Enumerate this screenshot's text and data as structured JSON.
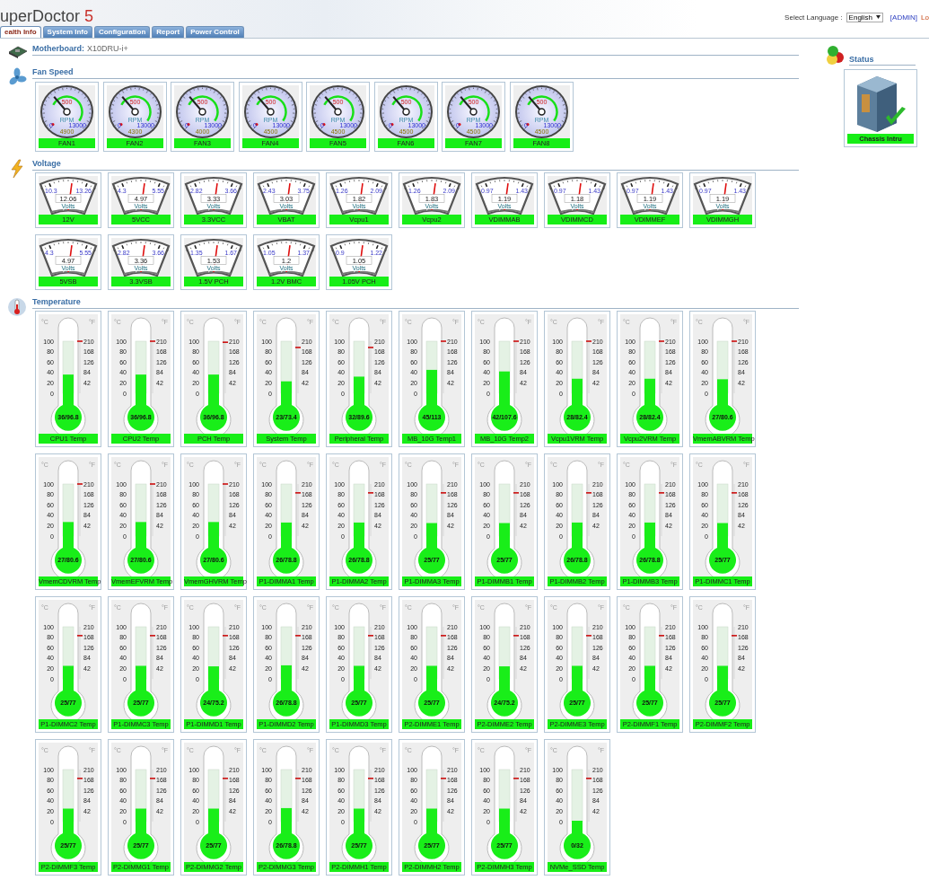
{
  "header": {
    "logo": {
      "name": "uperDoctor",
      "version": "5"
    },
    "tabs": [
      {
        "label": "ealth Info",
        "selected": true
      },
      {
        "label": "System Info",
        "selected": false
      },
      {
        "label": "Configuration",
        "selected": false
      },
      {
        "label": "Report",
        "selected": false
      },
      {
        "label": "Power Control",
        "selected": false
      }
    ],
    "language": {
      "label": "Select Language :",
      "value": "English"
    },
    "user": "[ADMIN]",
    "logout": "Lo"
  },
  "motherboard": {
    "label": "Motherboard:",
    "value": "X10DRU-i+"
  },
  "sections": [
    {
      "kind": "fan",
      "title": "Fan Speed",
      "gauges": [
        {
          "name": "FAN1",
          "limit": "500",
          "unit": "RPM",
          "min": "0",
          "max": "13000",
          "reading": "4900"
        },
        {
          "name": "FAN2",
          "limit": "500",
          "unit": "RPM",
          "min": "0",
          "max": "13000",
          "reading": "4300"
        },
        {
          "name": "FAN3",
          "limit": "500",
          "unit": "RPM",
          "min": "0",
          "max": "13000",
          "reading": "4000"
        },
        {
          "name": "FAN4",
          "limit": "500",
          "unit": "RPM",
          "min": "0",
          "max": "13000",
          "reading": "4500"
        },
        {
          "name": "FAN5",
          "limit": "500",
          "unit": "RPM",
          "min": "0",
          "max": "13000",
          "reading": "4500"
        },
        {
          "name": "FAN6",
          "limit": "500",
          "unit": "RPM",
          "min": "0",
          "max": "13000",
          "reading": "4500"
        },
        {
          "name": "FAN7",
          "limit": "500",
          "unit": "RPM",
          "min": "0",
          "max": "13000",
          "reading": "4500"
        },
        {
          "name": "FAN8",
          "limit": "500",
          "unit": "RPM",
          "min": "0",
          "max": "13000",
          "reading": "4500"
        }
      ]
    },
    {
      "kind": "voltage",
      "title": "Voltage",
      "gauges": [
        {
          "name": "12V",
          "min": "10.3",
          "max": "13.26",
          "reading": "12.06",
          "unit": "Volts"
        },
        {
          "name": "5VCC",
          "min": "4.3",
          "max": "5.55",
          "reading": "4.97",
          "unit": "Volts"
        },
        {
          "name": "3.3VCC",
          "min": "2.82",
          "max": "3.66",
          "reading": "3.33",
          "unit": "Volts"
        },
        {
          "name": "VBAT",
          "min": "2.43",
          "max": "3.75",
          "reading": "3.03",
          "unit": "Volts"
        },
        {
          "name": "Vcpu1",
          "min": "1.26",
          "max": "2.09",
          "reading": "1.82",
          "unit": "Volts"
        },
        {
          "name": "Vcpu2",
          "min": "1.26",
          "max": "2.09",
          "reading": "1.83",
          "unit": "Volts"
        },
        {
          "name": "VDIMMAB",
          "min": "0.97",
          "max": "1.43",
          "reading": "1.19",
          "unit": "Volts"
        },
        {
          "name": "VDIMMCD",
          "min": "0.97",
          "max": "1.43",
          "reading": "1.18",
          "unit": "Volts"
        },
        {
          "name": "VDIMMEF",
          "min": "0.97",
          "max": "1.43",
          "reading": "1.19",
          "unit": "Volts"
        },
        {
          "name": "VDIMMGH",
          "min": "0.97",
          "max": "1.43",
          "reading": "1.19",
          "unit": "Volts"
        },
        {
          "name": "5VSB",
          "min": "4.3",
          "max": "5.55",
          "reading": "4.97",
          "unit": "Volts"
        },
        {
          "name": "3.3VSB",
          "min": "2.82",
          "max": "3.66",
          "reading": "3.36",
          "unit": "Volts"
        },
        {
          "name": "1.5V PCH",
          "min": "1.35",
          "max": "1.67",
          "reading": "1.53",
          "unit": "Volts"
        },
        {
          "name": "1.2V BMC",
          "min": "1.05",
          "max": "1.37",
          "reading": "1.2",
          "unit": "Volts"
        },
        {
          "name": "1.05V PCH",
          "min": "0.9",
          "max": "1.22",
          "reading": "1.05",
          "unit": "Volts"
        }
      ]
    },
    {
      "kind": "temperature",
      "title": "Temperature",
      "gauges": [
        {
          "name": "CPU1 Temp",
          "reading": "36/96.8",
          "level": 0.36,
          "limit": {
            "level": 1.0
          },
          "celsius_unit": "°C",
          "fahrenheit_unit": "°F",
          "celsius": [
            "100",
            "80",
            "60",
            "40",
            "20",
            "0"
          ],
          "fahrenheit": [
            "210",
            "168",
            "126",
            "84",
            "42"
          ]
        },
        {
          "name": "CPU2 Temp",
          "reading": "36/96.8",
          "level": 0.36,
          "limit": {
            "level": 1.0
          },
          "celsius_unit": "°C",
          "fahrenheit_unit": "°F",
          "celsius": [
            "100",
            "80",
            "60",
            "40",
            "20",
            "0"
          ],
          "fahrenheit": [
            "210",
            "168",
            "126",
            "84",
            "42"
          ]
        },
        {
          "name": "PCH Temp",
          "reading": "36/96.8",
          "level": 0.36,
          "limit": {
            "level": 0.98
          },
          "celsius_unit": "°C",
          "fahrenheit_unit": "°F",
          "celsius": [
            "100",
            "80",
            "60",
            "40",
            "20",
            "0"
          ],
          "fahrenheit": [
            "210",
            "168",
            "126",
            "84",
            "42"
          ]
        },
        {
          "name": "System Temp",
          "reading": "23/73.4",
          "level": 0.23,
          "limit": {
            "level": 0.88
          },
          "celsius_unit": "°C",
          "fahrenheit_unit": "°F",
          "celsius": [
            "100",
            "80",
            "60",
            "40",
            "20",
            "0"
          ],
          "fahrenheit": [
            "210",
            "168",
            "126",
            "84",
            "42"
          ]
        },
        {
          "name": "Peripheral Temp",
          "reading": "32/89.6",
          "level": 0.32,
          "limit": {
            "level": 0.88
          },
          "celsius_unit": "°C",
          "fahrenheit_unit": "°F",
          "celsius": [
            "100",
            "80",
            "60",
            "40",
            "20",
            "0"
          ],
          "fahrenheit": [
            "210",
            "168",
            "126",
            "84",
            "42"
          ]
        },
        {
          "name": "MB_10G Temp1",
          "reading": "45/113",
          "level": 0.45,
          "limit": {
            "level": 1.0
          },
          "celsius_unit": "°C",
          "fahrenheit_unit": "°F",
          "celsius": [
            "100",
            "80",
            "60",
            "40",
            "20",
            "0"
          ],
          "fahrenheit": [
            "210",
            "168",
            "126",
            "84",
            "42"
          ]
        },
        {
          "name": "MB_10G Temp2",
          "reading": "42/107.6",
          "level": 0.42,
          "limit": {
            "level": 1.0
          },
          "celsius_unit": "°C",
          "fahrenheit_unit": "°F",
          "celsius": [
            "100",
            "80",
            "60",
            "40",
            "20",
            "0"
          ],
          "fahrenheit": [
            "210",
            "168",
            "126",
            "84",
            "42"
          ]
        },
        {
          "name": "Vcpu1VRM Temp",
          "reading": "28/82.4",
          "level": 0.28,
          "limit": {
            "level": 1.0
          },
          "celsius_unit": "°C",
          "fahrenheit_unit": "°F",
          "celsius": [
            "100",
            "80",
            "60",
            "40",
            "20",
            "0"
          ],
          "fahrenheit": [
            "210",
            "168",
            "126",
            "84",
            "42"
          ]
        },
        {
          "name": "Vcpu2VRM Temp",
          "reading": "28/82.4",
          "level": 0.28,
          "limit": {
            "level": 1.0
          },
          "celsius_unit": "°C",
          "fahrenheit_unit": "°F",
          "celsius": [
            "100",
            "80",
            "60",
            "40",
            "20",
            "0"
          ],
          "fahrenheit": [
            "210",
            "168",
            "126",
            "84",
            "42"
          ]
        },
        {
          "name": "VmemABVRM Temp",
          "reading": "27/80.6",
          "level": 0.27,
          "limit": {
            "level": 1.0
          },
          "celsius_unit": "°C",
          "fahrenheit_unit": "°F",
          "celsius": [
            "100",
            "80",
            "60",
            "40",
            "20",
            "0"
          ],
          "fahrenheit": [
            "210",
            "168",
            "126",
            "84",
            "42"
          ]
        },
        {
          "name": "VmemCDVRM Temp",
          "reading": "27/80.6",
          "level": 0.27,
          "limit": {
            "level": 1.0
          },
          "celsius_unit": "°C",
          "fahrenheit_unit": "°F",
          "celsius": [
            "100",
            "80",
            "60",
            "40",
            "20",
            "0"
          ],
          "fahrenheit": [
            "210",
            "168",
            "126",
            "84",
            "42"
          ]
        },
        {
          "name": "VmemEFVRM Temp",
          "reading": "27/80.6",
          "level": 0.27,
          "limit": {
            "level": 1.0
          },
          "celsius_unit": "°C",
          "fahrenheit_unit": "°F",
          "celsius": [
            "100",
            "80",
            "60",
            "40",
            "20",
            "0"
          ],
          "fahrenheit": [
            "210",
            "168",
            "126",
            "84",
            "42"
          ]
        },
        {
          "name": "VmemGHVRM Temp",
          "reading": "27/80.6",
          "level": 0.27,
          "limit": {
            "level": 1.0
          },
          "celsius_unit": "°C",
          "fahrenheit_unit": "°F",
          "celsius": [
            "100",
            "80",
            "60",
            "40",
            "20",
            "0"
          ],
          "fahrenheit": [
            "210",
            "168",
            "126",
            "84",
            "42"
          ]
        },
        {
          "name": "P1-DIMMA1 Temp",
          "reading": "26/78.8",
          "level": 0.26,
          "limit": {
            "level": 0.83
          },
          "celsius_unit": "°C",
          "fahrenheit_unit": "°F",
          "celsius": [
            "100",
            "80",
            "60",
            "40",
            "20",
            "0"
          ],
          "fahrenheit": [
            "210",
            "168",
            "126",
            "84",
            "42"
          ]
        },
        {
          "name": "P1-DIMMA2 Temp",
          "reading": "26/78.8",
          "level": 0.26,
          "limit": {
            "level": 0.83
          },
          "celsius_unit": "°C",
          "fahrenheit_unit": "°F",
          "celsius": [
            "100",
            "80",
            "60",
            "40",
            "20",
            "0"
          ],
          "fahrenheit": [
            "210",
            "168",
            "126",
            "84",
            "42"
          ]
        },
        {
          "name": "P1-DIMMA3 Temp",
          "reading": "25/77",
          "level": 0.25,
          "limit": {
            "level": 0.83
          },
          "celsius_unit": "°C",
          "fahrenheit_unit": "°F",
          "celsius": [
            "100",
            "80",
            "60",
            "40",
            "20",
            "0"
          ],
          "fahrenheit": [
            "210",
            "168",
            "126",
            "84",
            "42"
          ]
        },
        {
          "name": "P1-DIMMB1 Temp",
          "reading": "25/77",
          "level": 0.25,
          "limit": {
            "level": 0.83
          },
          "celsius_unit": "°C",
          "fahrenheit_unit": "°F",
          "celsius": [
            "100",
            "80",
            "60",
            "40",
            "20",
            "0"
          ],
          "fahrenheit": [
            "210",
            "168",
            "126",
            "84",
            "42"
          ]
        },
        {
          "name": "P1-DIMMB2 Temp",
          "reading": "26/78.8",
          "level": 0.26,
          "limit": {
            "level": 0.83
          },
          "celsius_unit": "°C",
          "fahrenheit_unit": "°F",
          "celsius": [
            "100",
            "80",
            "60",
            "40",
            "20",
            "0"
          ],
          "fahrenheit": [
            "210",
            "168",
            "126",
            "84",
            "42"
          ]
        },
        {
          "name": "P1-DIMMB3 Temp",
          "reading": "26/78.8",
          "level": 0.26,
          "limit": {
            "level": 0.83
          },
          "celsius_unit": "°C",
          "fahrenheit_unit": "°F",
          "celsius": [
            "100",
            "80",
            "60",
            "40",
            "20",
            "0"
          ],
          "fahrenheit": [
            "210",
            "168",
            "126",
            "84",
            "42"
          ]
        },
        {
          "name": "P1-DIMMC1 Temp",
          "reading": "25/77",
          "level": 0.25,
          "limit": {
            "level": 0.83
          },
          "celsius_unit": "°C",
          "fahrenheit_unit": "°F",
          "celsius": [
            "100",
            "80",
            "60",
            "40",
            "20",
            "0"
          ],
          "fahrenheit": [
            "210",
            "168",
            "126",
            "84",
            "42"
          ]
        },
        {
          "name": "P1-DIMMC2 Temp",
          "reading": "25/77",
          "level": 0.25,
          "limit": {
            "level": 0.83
          },
          "celsius_unit": "°C",
          "fahrenheit_unit": "°F",
          "celsius": [
            "100",
            "80",
            "60",
            "40",
            "20",
            "0"
          ],
          "fahrenheit": [
            "210",
            "168",
            "126",
            "84",
            "42"
          ]
        },
        {
          "name": "P1-DIMMC3 Temp",
          "reading": "25/77",
          "level": 0.25,
          "limit": {
            "level": 0.83
          },
          "celsius_unit": "°C",
          "fahrenheit_unit": "°F",
          "celsius": [
            "100",
            "80",
            "60",
            "40",
            "20",
            "0"
          ],
          "fahrenheit": [
            "210",
            "168",
            "126",
            "84",
            "42"
          ]
        },
        {
          "name": "P1-DIMMD1 Temp",
          "reading": "24/75.2",
          "level": 0.24,
          "limit": {
            "level": 0.83
          },
          "celsius_unit": "°C",
          "fahrenheit_unit": "°F",
          "celsius": [
            "100",
            "80",
            "60",
            "40",
            "20",
            "0"
          ],
          "fahrenheit": [
            "210",
            "168",
            "126",
            "84",
            "42"
          ]
        },
        {
          "name": "P1-DIMMD2 Temp",
          "reading": "26/78.8",
          "level": 0.26,
          "limit": {
            "level": 0.83
          },
          "celsius_unit": "°C",
          "fahrenheit_unit": "°F",
          "celsius": [
            "100",
            "80",
            "60",
            "40",
            "20",
            "0"
          ],
          "fahrenheit": [
            "210",
            "168",
            "126",
            "84",
            "42"
          ]
        },
        {
          "name": "P1-DIMMD3 Temp",
          "reading": "25/77",
          "level": 0.25,
          "limit": {
            "level": 0.83
          },
          "celsius_unit": "°C",
          "fahrenheit_unit": "°F",
          "celsius": [
            "100",
            "80",
            "60",
            "40",
            "20",
            "0"
          ],
          "fahrenheit": [
            "210",
            "168",
            "126",
            "84",
            "42"
          ]
        },
        {
          "name": "P2-DIMME1 Temp",
          "reading": "25/77",
          "level": 0.25,
          "limit": {
            "level": 0.83
          },
          "celsius_unit": "°C",
          "fahrenheit_unit": "°F",
          "celsius": [
            "100",
            "80",
            "60",
            "40",
            "20",
            "0"
          ],
          "fahrenheit": [
            "210",
            "168",
            "126",
            "84",
            "42"
          ]
        },
        {
          "name": "P2-DIMME2 Temp",
          "reading": "24/75.2",
          "level": 0.24,
          "limit": {
            "level": 0.83
          },
          "celsius_unit": "°C",
          "fahrenheit_unit": "°F",
          "celsius": [
            "100",
            "80",
            "60",
            "40",
            "20",
            "0"
          ],
          "fahrenheit": [
            "210",
            "168",
            "126",
            "84",
            "42"
          ]
        },
        {
          "name": "P2-DIMME3 Temp",
          "reading": "25/77",
          "level": 0.25,
          "limit": {
            "level": 0.83
          },
          "celsius_unit": "°C",
          "fahrenheit_unit": "°F",
          "celsius": [
            "100",
            "80",
            "60",
            "40",
            "20",
            "0"
          ],
          "fahrenheit": [
            "210",
            "168",
            "126",
            "84",
            "42"
          ]
        },
        {
          "name": "P2-DIMMF1 Temp",
          "reading": "25/77",
          "level": 0.25,
          "limit": {
            "level": 0.83
          },
          "celsius_unit": "°C",
          "fahrenheit_unit": "°F",
          "celsius": [
            "100",
            "80",
            "60",
            "40",
            "20",
            "0"
          ],
          "fahrenheit": [
            "210",
            "168",
            "126",
            "84",
            "42"
          ]
        },
        {
          "name": "P2-DIMMF2 Temp",
          "reading": "25/77",
          "level": 0.25,
          "limit": {
            "level": 0.83
          },
          "celsius_unit": "°C",
          "fahrenheit_unit": "°F",
          "celsius": [
            "100",
            "80",
            "60",
            "40",
            "20",
            "0"
          ],
          "fahrenheit": [
            "210",
            "168",
            "126",
            "84",
            "42"
          ]
        },
        {
          "name": "P2-DIMMF3 Temp",
          "reading": "25/77",
          "level": 0.25,
          "limit": {
            "level": 0.83
          },
          "celsius_unit": "°C",
          "fahrenheit_unit": "°F",
          "celsius": [
            "100",
            "80",
            "60",
            "40",
            "20",
            "0"
          ],
          "fahrenheit": [
            "210",
            "168",
            "126",
            "84",
            "42"
          ]
        },
        {
          "name": "P2-DIMMG1 Temp",
          "reading": "25/77",
          "level": 0.25,
          "limit": {
            "level": 0.83
          },
          "celsius_unit": "°C",
          "fahrenheit_unit": "°F",
          "celsius": [
            "100",
            "80",
            "60",
            "40",
            "20",
            "0"
          ],
          "fahrenheit": [
            "210",
            "168",
            "126",
            "84",
            "42"
          ]
        },
        {
          "name": "P2-DIMMG2 Temp",
          "reading": "25/77",
          "level": 0.25,
          "limit": {
            "level": 0.83
          },
          "celsius_unit": "°C",
          "fahrenheit_unit": "°F",
          "celsius": [
            "100",
            "80",
            "60",
            "40",
            "20",
            "0"
          ],
          "fahrenheit": [
            "210",
            "168",
            "126",
            "84",
            "42"
          ]
        },
        {
          "name": "P2-DIMMG3 Temp",
          "reading": "26/78.8",
          "level": 0.26,
          "limit": {
            "level": 0.83
          },
          "celsius_unit": "°C",
          "fahrenheit_unit": "°F",
          "celsius": [
            "100",
            "80",
            "60",
            "40",
            "20",
            "0"
          ],
          "fahrenheit": [
            "210",
            "168",
            "126",
            "84",
            "42"
          ]
        },
        {
          "name": "P2-DIMMH1 Temp",
          "reading": "25/77",
          "level": 0.25,
          "limit": {
            "level": 0.83
          },
          "celsius_unit": "°C",
          "fahrenheit_unit": "°F",
          "celsius": [
            "100",
            "80",
            "60",
            "40",
            "20",
            "0"
          ],
          "fahrenheit": [
            "210",
            "168",
            "126",
            "84",
            "42"
          ]
        },
        {
          "name": "P2-DIMMH2 Temp",
          "reading": "25/77",
          "level": 0.25,
          "limit": {
            "level": 0.83
          },
          "celsius_unit": "°C",
          "fahrenheit_unit": "°F",
          "celsius": [
            "100",
            "80",
            "60",
            "40",
            "20",
            "0"
          ],
          "fahrenheit": [
            "210",
            "168",
            "126",
            "84",
            "42"
          ]
        },
        {
          "name": "P2-DIMMH3 Temp",
          "reading": "25/77",
          "level": 0.25,
          "limit": {
            "level": 0.83
          },
          "celsius_unit": "°C",
          "fahrenheit_unit": "°F",
          "celsius": [
            "100",
            "80",
            "60",
            "40",
            "20",
            "0"
          ],
          "fahrenheit": [
            "210",
            "168",
            "126",
            "84",
            "42"
          ]
        },
        {
          "name": "NVMe_SSD Temp",
          "reading": "0/32",
          "level": 0.0,
          "limit": {
            "level": 0.83
          },
          "celsius_unit": "°C",
          "fahrenheit_unit": "°F",
          "celsius": [
            "100",
            "80",
            "60",
            "40",
            "20",
            "0"
          ],
          "fahrenheit": [
            "210",
            "168",
            "126",
            "84",
            "42"
          ]
        }
      ]
    }
  ],
  "status": {
    "title": "Status",
    "items": [
      {
        "name": "Chassis Intru",
        "ok": true
      }
    ]
  }
}
